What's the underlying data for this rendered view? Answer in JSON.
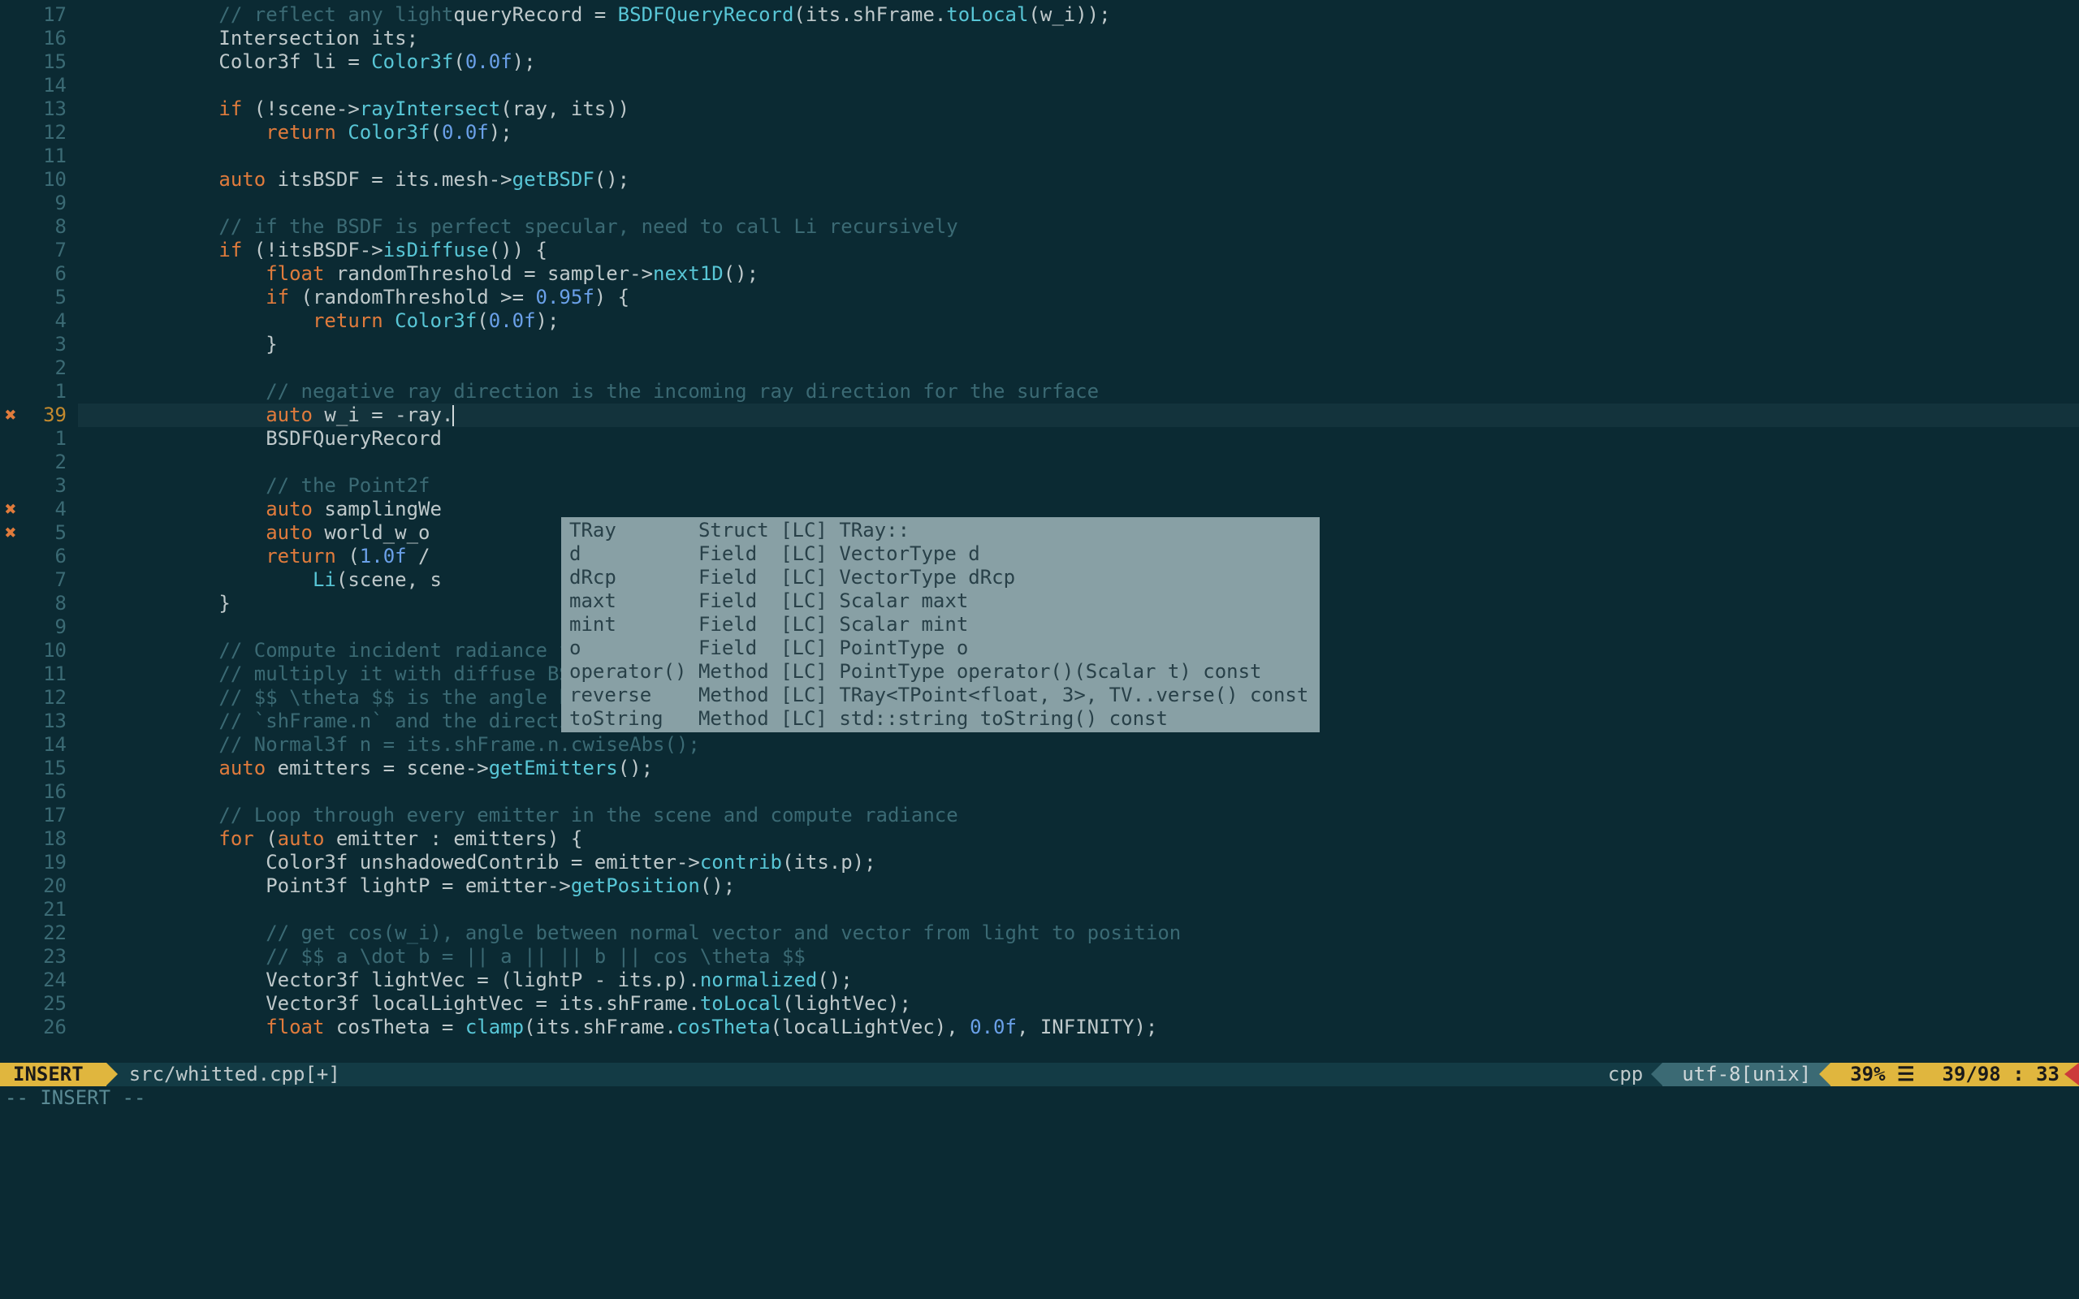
{
  "gutter": {
    "lines": [
      {
        "n": "17"
      },
      {
        "n": "16"
      },
      {
        "n": "15"
      },
      {
        "n": "14"
      },
      {
        "n": "13"
      },
      {
        "n": "12"
      },
      {
        "n": "11"
      },
      {
        "n": "10"
      },
      {
        "n": "9"
      },
      {
        "n": "8"
      },
      {
        "n": "7"
      },
      {
        "n": "6"
      },
      {
        "n": "5"
      },
      {
        "n": "4"
      },
      {
        "n": "3"
      },
      {
        "n": "2"
      },
      {
        "n": "1"
      },
      {
        "n": "39",
        "current": true,
        "mark": "✖"
      },
      {
        "n": "1"
      },
      {
        "n": "2"
      },
      {
        "n": "3"
      },
      {
        "n": "4",
        "mark": "✖"
      },
      {
        "n": "5",
        "mark": "✖"
      },
      {
        "n": "6"
      },
      {
        "n": "7"
      },
      {
        "n": "8"
      },
      {
        "n": "9"
      },
      {
        "n": "10"
      },
      {
        "n": "11"
      },
      {
        "n": "12"
      },
      {
        "n": "13"
      },
      {
        "n": "14"
      },
      {
        "n": "15"
      },
      {
        "n": "16"
      },
      {
        "n": "17"
      },
      {
        "n": "18"
      },
      {
        "n": "19"
      },
      {
        "n": "20"
      },
      {
        "n": "21"
      },
      {
        "n": "22"
      },
      {
        "n": "23"
      },
      {
        "n": "24"
      },
      {
        "n": "25"
      },
      {
        "n": "26"
      }
    ]
  },
  "code": {
    "l0": {
      "c0": "// reflect any light",
      "c1": "queryRecord = ",
      "c2": "BSDFQueryRecord",
      "c3": "(its.shFrame.",
      "c4": "toLocal",
      "c5": "(w_i));"
    },
    "l1": {
      "c0": "Intersection its;"
    },
    "l2": {
      "c0": "Color3f li = ",
      "c1": "Color3f",
      "c2": "(",
      "c3": "0.0f",
      "c4": ");"
    },
    "l3": {
      "c0": ""
    },
    "l4": {
      "c0": "if",
      "c1": " (!scene->",
      "c2": "rayIntersect",
      "c3": "(ray, its))"
    },
    "l5": {
      "c0": "return",
      "c1": " ",
      "c2": "Color3f",
      "c3": "(",
      "c4": "0.0f",
      "c5": ");"
    },
    "l6": {
      "c0": ""
    },
    "l7": {
      "c0": "auto",
      "c1": " itsBSDF = its.mesh->",
      "c2": "getBSDF",
      "c3": "();"
    },
    "l8": {
      "c0": ""
    },
    "l9": {
      "c0": "// if the BSDF is perfect specular, need to call Li recursively"
    },
    "l10": {
      "c0": "if",
      "c1": " (!itsBSDF->",
      "c2": "isDiffuse",
      "c3": "()) {"
    },
    "l11": {
      "c0": "float",
      "c1": " randomThreshold = sampler->",
      "c2": "next1D",
      "c3": "();"
    },
    "l12": {
      "c0": "if",
      "c1": " (randomThreshold >= ",
      "c2": "0.95f",
      "c3": ") {"
    },
    "l13": {
      "c0": "return",
      "c1": " ",
      "c2": "Color3f",
      "c3": "(",
      "c4": "0.0f",
      "c5": ");"
    },
    "l14": {
      "c0": "}"
    },
    "l15": {
      "c0": ""
    },
    "l16": {
      "c0": "// negative ray direction is the incoming ray direction for the surface"
    },
    "l17": {
      "c0": "auto",
      "c1": " w_i = -ray."
    },
    "l18": {
      "c0": "BSDFQueryRecord"
    },
    "l19": {
      "c0": ""
    },
    "l20": {
      "c0": "// the Point2f"
    },
    "l21": {
      "c0": "auto",
      "c1": " samplingWe"
    },
    "l22": {
      "c0": "auto",
      "c1": " world_w_o "
    },
    "l23": {
      "c0": "return",
      "c1": " (",
      "c2": "1.0f",
      "c3": " / "
    },
    "l24": {
      "c0": "Li",
      "c1": "(scene, s"
    },
    "l25": {
      "c0": "}"
    },
    "l26": {
      "c0": ""
    },
    "l27": {
      "c0": "// Compute incident radiance from all point lights in the scene"
    },
    "l28": {
      "c0": "// multiply it with diffuse BSDF and $$ cos \\theta $$ where"
    },
    "l29": {
      "c0": "// $$ \\theta $$ is the angle between the shading normal (given by"
    },
    "l30": {
      "c0": "// `shFrame.n` and the direction _towards_ the light source"
    },
    "l31": {
      "c0": "// Normal3f n = its.shFrame.n.cwiseAbs();"
    },
    "l32": {
      "c0": "auto",
      "c1": " emitters = scene->",
      "c2": "getEmitters",
      "c3": "();"
    },
    "l33": {
      "c0": ""
    },
    "l34": {
      "c0": "// Loop through every emitter in the scene and compute radiance"
    },
    "l35": {
      "c0": "for",
      "c1": " (",
      "c2": "auto",
      "c3": " emitter : emitters) {"
    },
    "l36": {
      "c0": "Color3f unshadowedContrib = emitter->",
      "c1": "contrib",
      "c2": "(its.p);"
    },
    "l37": {
      "c0": "Point3f lightP = emitter->",
      "c1": "getPosition",
      "c2": "();"
    },
    "l38": {
      "c0": ""
    },
    "l39": {
      "c0": "// get cos(w_i), angle between normal vector and vector from light to position"
    },
    "l40": {
      "c0": "// $$ a \\dot b = || a || || b || cos \\theta $$"
    },
    "l41": {
      "c0": "Vector3f lightVec = (lightP - its.p).",
      "c1": "normalized",
      "c2": "();"
    },
    "l42": {
      "c0": "Vector3f localLightVec = its.shFrame.",
      "c1": "toLocal",
      "c2": "(lightVec);"
    },
    "l43": {
      "c0": "float",
      "c1": " cosTheta = ",
      "c2": "clamp",
      "c3": "(its.shFrame.",
      "c4": "cosTheta",
      "c5": "(localLightVec), ",
      "c6": "0.0f",
      "c7": ", INFINITY);"
    }
  },
  "popup": {
    "rows": [
      "TRay       Struct [LC] TRay::",
      "d          Field  [LC] VectorType d",
      "dRcp       Field  [LC] VectorType dRcp",
      "maxt       Field  [LC] Scalar maxt",
      "mint       Field  [LC] Scalar mint",
      "o          Field  [LC] PointType o",
      "operator() Method [LC] PointType operator()(Scalar t) const",
      "reverse    Method [LC] TRay<TPoint<float, 3>, TV..verse() const",
      "toString   Method [LC] std::string toString() const"
    ]
  },
  "status": {
    "mode": "INSERT",
    "file": "src/whitted.cpp[+]",
    "filetype": "cpp",
    "encoding": "utf-8[unix]",
    "percent": "39% ☰",
    "position": "39/98 : 33"
  },
  "modemsg": "-- INSERT --"
}
